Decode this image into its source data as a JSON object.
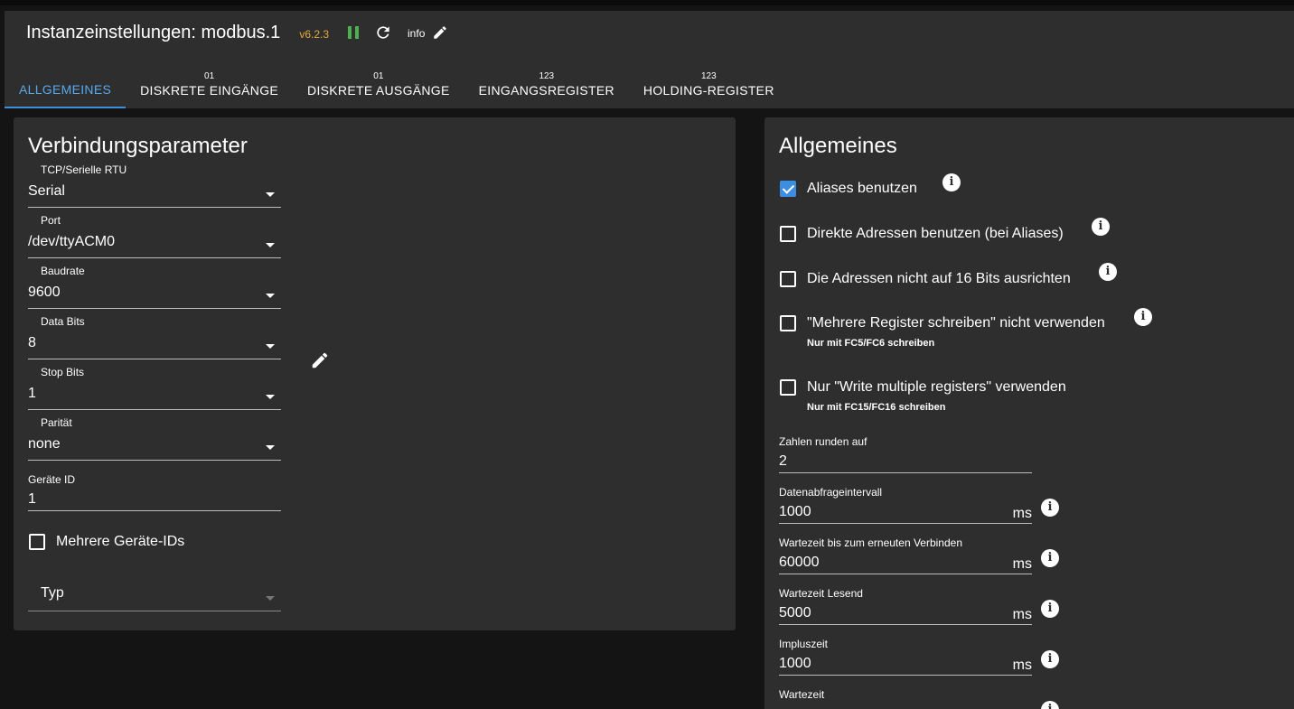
{
  "header": {
    "title": "Instanzeinstellungen: modbus.1",
    "version": "v6.2.3",
    "info_label": "info",
    "icons": [
      "pause-icon",
      "reload-icon",
      "pencil-icon"
    ]
  },
  "tabs": [
    {
      "icon": "",
      "label": "ALLGEMEINES",
      "active": true
    },
    {
      "icon": "01",
      "label": "DISKRETE EINGÄNGE"
    },
    {
      "icon": "01",
      "label": "DISKRETE AUSGÄNGE"
    },
    {
      "icon": "123",
      "label": "EINGANGSREGISTER"
    },
    {
      "icon": "123",
      "label": "HOLDING-REGISTER"
    }
  ],
  "connection": {
    "heading": "Verbindungsparameter",
    "fields": [
      {
        "label": "TCP/Serielle RTU",
        "value": "Serial"
      },
      {
        "label": "Port",
        "value": "/dev/ttyACM0"
      },
      {
        "label": "Baudrate",
        "value": "9600"
      },
      {
        "label": "Data Bits",
        "value": "8"
      },
      {
        "label": "Stop Bits",
        "value": "1"
      },
      {
        "label": "Parität",
        "value": "none"
      }
    ],
    "device_id": {
      "label": "Geräte ID",
      "value": "1"
    },
    "multi_ids": {
      "label": "Mehrere Geräte-IDs",
      "checked": false
    },
    "type": {
      "placeholder": "Typ"
    }
  },
  "general": {
    "heading": "Allgemeines",
    "checkboxes": [
      {
        "label": "Aliases benutzen",
        "checked": true,
        "hint": ""
      },
      {
        "label": "Direkte Adressen benutzen (bei Aliases)",
        "checked": false,
        "hint": ""
      },
      {
        "label": "Die Adressen nicht auf 16 Bits ausrichten",
        "checked": false,
        "hint": ""
      },
      {
        "label": "\"Mehrere Register schreiben\" nicht verwenden",
        "checked": false,
        "hint": "Nur mit FC5/FC6 schreiben"
      },
      {
        "label": "Nur \"Write multiple registers\" verwenden",
        "checked": false,
        "hint": "Nur mit FC15/FC16 schreiben"
      }
    ],
    "round": {
      "label": "Zahlen runden auf",
      "value": "2"
    },
    "fields": [
      {
        "label": "Datenabfrageintervall",
        "value": "1000",
        "unit": "ms"
      },
      {
        "label": "Wartezeit bis zum erneuten Verbinden",
        "value": "60000",
        "unit": "ms"
      },
      {
        "label": "Wartezeit Lesend",
        "value": "5000",
        "unit": "ms"
      },
      {
        "label": "Impluszeit",
        "value": "1000",
        "unit": "ms"
      },
      {
        "label": "Wartezeit",
        "value": "",
        "unit": ""
      }
    ]
  },
  "colors": {
    "accent": "#3d8ee0",
    "version": "#e3a93a",
    "pause": "#4caf50",
    "panel": "#2e2e2e",
    "background": "#141414"
  }
}
